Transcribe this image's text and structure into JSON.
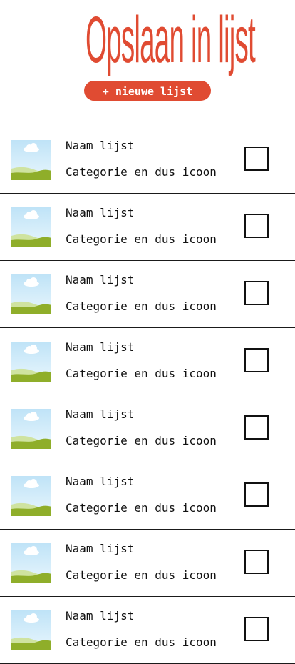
{
  "header": {
    "title": "Opslaan in lijst",
    "new_list_label": "+ nieuwe lijst"
  },
  "lists": [
    {
      "name": "Naam lijst",
      "category": "Categorie en dus icoon",
      "checked": false
    },
    {
      "name": "Naam lijst",
      "category": "Categorie en dus icoon",
      "checked": false
    },
    {
      "name": "Naam lijst",
      "category": "Categorie en dus icoon",
      "checked": false
    },
    {
      "name": "Naam lijst",
      "category": "Categorie en dus icoon",
      "checked": false
    },
    {
      "name": "Naam lijst",
      "category": "Categorie en dus icoon",
      "checked": false
    },
    {
      "name": "Naam lijst",
      "category": "Categorie en dus icoon",
      "checked": false
    },
    {
      "name": "Naam lijst",
      "category": "Categorie en dus icoon",
      "checked": false
    },
    {
      "name": "Naam lijst",
      "category": "Categorie en dus icoon",
      "checked": false
    }
  ],
  "colors": {
    "accent": "#e04b32",
    "text": "#111111",
    "divider": "#1a1a1a"
  },
  "icons": {
    "thumbnail": "landscape-placeholder-icon"
  }
}
